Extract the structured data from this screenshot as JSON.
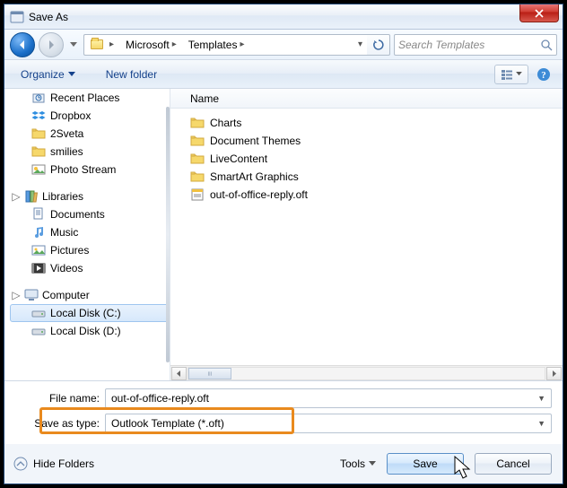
{
  "window": {
    "title": "Save As"
  },
  "nav": {
    "path_segments": [
      "Microsoft",
      "Templates"
    ],
    "search_placeholder": "Search Templates"
  },
  "toolbar": {
    "organize": "Organize",
    "new_folder": "New folder"
  },
  "tree": {
    "favorites_items": [
      {
        "label": "Recent Places",
        "icon": "recent-places-icon"
      },
      {
        "label": "Dropbox",
        "icon": "dropbox-icon"
      },
      {
        "label": "2Sveta",
        "icon": "folder-icon"
      },
      {
        "label": "smilies",
        "icon": "folder-icon"
      },
      {
        "label": "Photo Stream",
        "icon": "photo-stream-icon"
      }
    ],
    "libraries_label": "Libraries",
    "libraries_items": [
      {
        "label": "Documents",
        "icon": "documents-icon"
      },
      {
        "label": "Music",
        "icon": "music-icon"
      },
      {
        "label": "Pictures",
        "icon": "pictures-icon"
      },
      {
        "label": "Videos",
        "icon": "videos-icon"
      }
    ],
    "computer_label": "Computer",
    "computer_items": [
      {
        "label": "Local Disk (C:)",
        "icon": "drive-icon",
        "selected": true
      },
      {
        "label": "Local Disk (D:)",
        "icon": "drive-icon"
      }
    ]
  },
  "list": {
    "header": "Name",
    "items": [
      {
        "label": "Charts",
        "type": "folder"
      },
      {
        "label": "Document Themes",
        "type": "folder"
      },
      {
        "label": "LiveContent",
        "type": "folder"
      },
      {
        "label": "SmartArt Graphics",
        "type": "folder"
      },
      {
        "label": "out-of-office-reply.oft",
        "type": "oft"
      }
    ]
  },
  "fields": {
    "filename_label": "File name:",
    "filename_value": "out-of-office-reply.oft",
    "savetype_label": "Save as type:",
    "savetype_value": "Outlook Template (*.oft)"
  },
  "footer": {
    "hide_folders": "Hide Folders",
    "tools": "Tools",
    "save": "Save",
    "cancel": "Cancel"
  },
  "colors": {
    "highlight": "#e98a1e",
    "accent": "#15428b"
  }
}
